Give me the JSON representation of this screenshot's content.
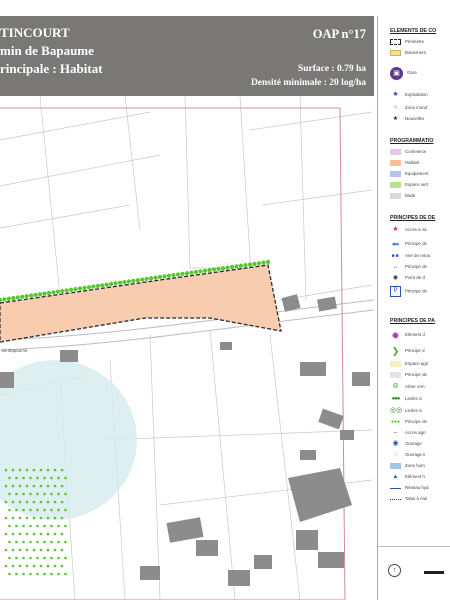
{
  "header": {
    "commune": "TINCOURT",
    "site": "min de Bapaume",
    "vocation": "rincipale : Habitat",
    "oap": "OAP n°17",
    "surface": "Surface : 0.79 ha",
    "density": "Densité minimale : 20 log/ha"
  },
  "map": {
    "road_label": "de Bapaume"
  },
  "legend": {
    "sections": [
      {
        "heading": "ELEMENTS DE CO",
        "items": [
          {
            "label": "Périmètre",
            "icon": "dashed-boundary-icon"
          },
          {
            "label": "Boisement",
            "icon": "yellow-square-icon"
          },
          {
            "label": "Gare",
            "icon": "train-station-icon"
          },
          {
            "label": "Exploitation",
            "icon": "blue-star-icon"
          },
          {
            "label": "Zone inond",
            "icon": "flood-zone-icon"
          },
          {
            "label": "Nouvelles",
            "icon": "small-star-icon"
          }
        ]
      },
      {
        "heading": "PROGRAMMATIO",
        "items": [
          {
            "label": "Commerce",
            "icon": "purple-swatch-icon"
          },
          {
            "label": "Habitat",
            "icon": "orange-swatch-icon"
          },
          {
            "label": "Equipement",
            "icon": "blue-swatch-icon"
          },
          {
            "label": "Espace vert",
            "icon": "green-swatch-icon"
          },
          {
            "label": "Mixte",
            "icon": "grey-swatch-icon"
          }
        ]
      },
      {
        "heading": "PRINCIPES DE DE",
        "items": [
          {
            "label": "Accès à va",
            "icon": "red-star-icon"
          },
          {
            "label": "Principe de",
            "icon": "blue-arrow-icon"
          },
          {
            "label": "Aire de retou",
            "icon": "blue-dots-icon"
          },
          {
            "label": "Principe de",
            "icon": "brown-double-arrow-icon"
          },
          {
            "label": "Point de d",
            "icon": "point-icon"
          },
          {
            "label": "Principe de",
            "icon": "parking-icon"
          }
        ]
      },
      {
        "heading": "PRINCIPES DE PA",
        "items": [
          {
            "label": "Elément d",
            "icon": "purple-flower-icon"
          },
          {
            "label": "Principe d",
            "icon": "green-chevron-icon"
          },
          {
            "label": "Espace agri",
            "icon": "light-yellow-swatch-icon"
          },
          {
            "label": "Principe de",
            "icon": "light-grey-swatch-icon"
          },
          {
            "label": "Arbre rem",
            "icon": "green-ring-icon"
          },
          {
            "label": "Lisière d",
            "icon": "green-hedge-icon"
          },
          {
            "label": "Lisière d",
            "icon": "double-ring-icon"
          },
          {
            "label": "Principe de",
            "icon": "green-dots-icon"
          },
          {
            "label": "Accès agri",
            "icon": "brown-arrows-icon"
          },
          {
            "label": "Ouvrage",
            "icon": "blue-circle-icon"
          },
          {
            "label": "Ouvrage e",
            "icon": "blue-circle-outline-icon"
          },
          {
            "label": "Zone hum",
            "icon": "light-blue-swatch-icon"
          },
          {
            "label": "Elément h",
            "icon": "blue-triangle-icon"
          },
          {
            "label": "Réseau hyd",
            "icon": "blue-line-icon"
          },
          {
            "label": "Talus à mai",
            "icon": "dotted-line-icon"
          }
        ]
      }
    ]
  }
}
